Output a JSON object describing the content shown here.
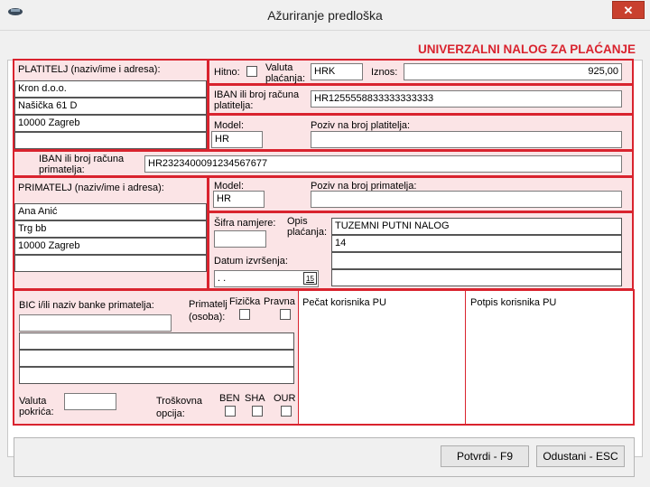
{
  "window": {
    "title": "Ažuriranje predloška",
    "close": "✕"
  },
  "form": {
    "heading": "UNIVERZALNI NALOG ZA PLAĆANJE",
    "payer": {
      "label": "PLATITELJ (naziv/ime i adresa):",
      "line1": "Kron d.o.o.",
      "line2": "Našička 61 D",
      "line3": "10000 Zagreb",
      "line4": ""
    },
    "urgent_label": "Hitno:",
    "currency": {
      "label1": "Valuta",
      "label2": "plaćanja:",
      "value": "HRK"
    },
    "amount": {
      "label": "Iznos:",
      "value": "925,00"
    },
    "payer_iban": {
      "label1": "IBAN ili broj računa",
      "label2": "platitelja:",
      "value": "HR1255558833333333333"
    },
    "payer_model": {
      "label": "Model:",
      "value": "HR"
    },
    "payer_ref": {
      "label": "Poziv na broj platitelja:",
      "value": ""
    },
    "recipient_iban": {
      "label1": "IBAN ili broj računa",
      "label2": "primatelja:",
      "value": "HR2323400091234567677"
    },
    "recipient": {
      "label": "PRIMATELJ (naziv/ime i adresa):",
      "line1": "Ana Anić",
      "line2": "Trg bb",
      "line3": "10000 Zagreb",
      "line4": ""
    },
    "recipient_model": {
      "label": "Model:",
      "value": "HR"
    },
    "recipient_ref": {
      "label": "Poziv na broj primatelja:",
      "value": ""
    },
    "purpose_code": {
      "label": "Šifra namjere:",
      "value": ""
    },
    "description": {
      "label1": "Opis",
      "label2": "plaćanja:",
      "line1": "TUZEMNI PUTNI NALOG",
      "line2": "14",
      "line3": "",
      "line4": ""
    },
    "execution_date": {
      "label": "Datum izvršenja:",
      "value": " .  .",
      "calendar": "15"
    },
    "bic": {
      "label": "BIC i/ili naziv banke primatelja:",
      "value": ""
    },
    "recipient_person": {
      "label1": "Primatelj",
      "label2": "(osoba):",
      "physical": "Fizička",
      "legal": "Pravna"
    },
    "cover_currency": {
      "label1": "Valuta",
      "label2": "pokrića:",
      "value": ""
    },
    "cost_option": {
      "label1": "Troškovna",
      "label2": "opcija:",
      "ben": "BEN",
      "sha": "SHA",
      "our": "OUR"
    },
    "stamp_label": "Pečat korisnika PU",
    "signature_label": "Potpis korisnika PU"
  },
  "buttons": {
    "confirm": "Potvrdi - F9",
    "cancel": "Odustani - ESC"
  },
  "colors": {
    "accent": "#d9232e",
    "section_fill": "#fbe4e6"
  }
}
